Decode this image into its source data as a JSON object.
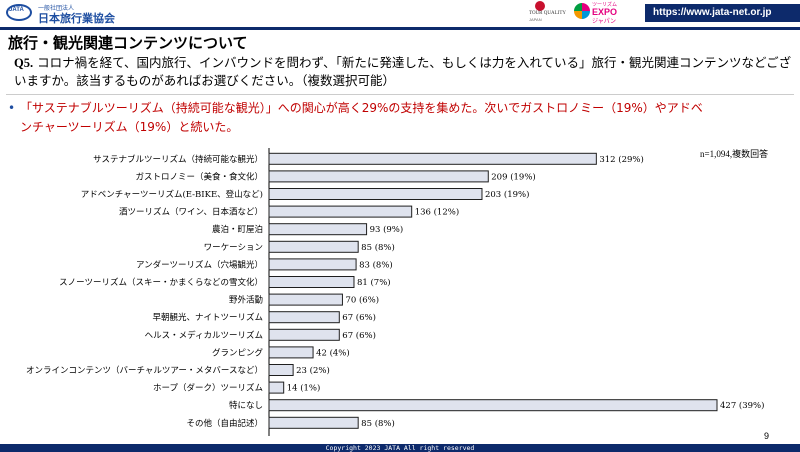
{
  "header": {
    "org_sub": "一般社団法人",
    "org_name": "日本旅行業協会",
    "org_abbr": "JATA",
    "quality_line1": "TOUR QUALITY",
    "quality_line2": "JAPAN",
    "expo_line1": "ツーリズム",
    "expo_line2": "EXPO",
    "expo_line3": "ジャパン",
    "url": "https://www.jata-net.or.jp"
  },
  "title": "旅行・観光関連コンテンツについて",
  "question": {
    "number": "Q5.",
    "text": "コロナ禍を経て、国内旅行、インバウンドを問わず、「新たに発達した、もしくは力を入れている」旅行・観光関連コンテンツなどございますか。該当するものがあればお選びください。（複数選択可能）"
  },
  "summary": {
    "bullet": "•",
    "text": "「サステナブルツーリズム（持続可能な観光）」への関心が高く29%の支持を集めた。次いでガストロノミー（19%）やアドベンチャーツーリズム（19%）と続いた。"
  },
  "note": "n=1,094,複数回答",
  "chart_data": {
    "type": "bar",
    "orientation": "horizontal",
    "categories": [
      "サステナブルツーリズム（持続可能な観光）",
      "ガストロノミー（美食・食文化）",
      "アドベンチャーツーリズム(E-BIKE、登山など)",
      "酒ツーリズム（ワイン、日本酒など）",
      "農泊・町屋泊",
      "ワーケーション",
      "アンダーツーリズム（穴場観光）",
      "スノーツーリズム（スキー・かまくらなどの雪文化）",
      "野外活動",
      "早朝観光、ナイトツーリズム",
      "ヘルス・メディカルツーリズム",
      "グランピング",
      "オンラインコンテンツ（バーチャルツアー・メタバースなど）",
      "ホープ（ダーク）ツーリズム",
      "特になし",
      "その他（自由記述）"
    ],
    "values": [
      312,
      209,
      203,
      136,
      93,
      85,
      83,
      81,
      70,
      67,
      67,
      42,
      23,
      14,
      427,
      85
    ],
    "data_labels": [
      "312 (29%)",
      "209 (19%)",
      "203 (19%)",
      "136 (12%)",
      "93 (9%)",
      "85 (8%)",
      "83 (8%)",
      "81 (7%)",
      "70 (6%)",
      "67 (6%)",
      "67 (6%)",
      "42 (4%)",
      "23 (2%)",
      "14 (1%)",
      "427 (39%)",
      "85 (8%)"
    ],
    "xlim": [
      0,
      427
    ],
    "grid": false,
    "bar_color": "#dfe3ee",
    "bar_border": "#1f1f1f"
  },
  "page_number": "9",
  "footer": "Copyright 2023 JATA  All right reserved"
}
